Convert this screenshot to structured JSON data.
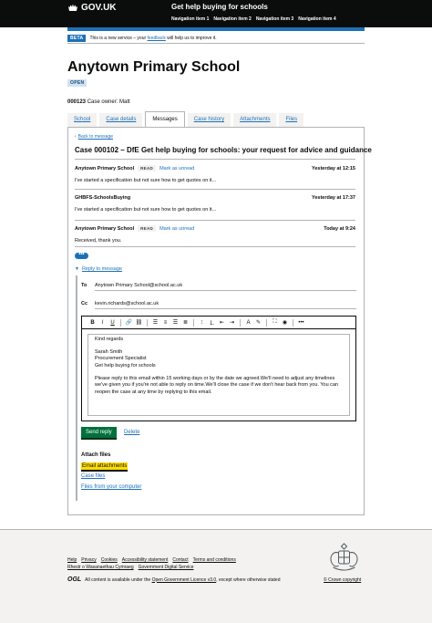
{
  "header": {
    "logo_text": "GOV.UK",
    "service_name": "Get help buying for schools",
    "nav": [
      "Navigation item 1",
      "Navigation item 2",
      "Navigation item 3",
      "Navigation item 4"
    ]
  },
  "phase_banner": {
    "tag": "BETA",
    "text_before": "This is a new service – your",
    "link": "feedback",
    "text_after": "will help us to improve it."
  },
  "page": {
    "title": "Anytown Primary School",
    "status_tag": "OPEN",
    "case_number": "000123",
    "case_owner": "Case owner: Matt"
  },
  "tabs": [
    "School",
    "Case details",
    "Messages",
    "Case history",
    "Attachments",
    "Files"
  ],
  "active_tab": "Messages",
  "thread": {
    "back_link": "Back to message",
    "title": "Case 000102 – DfE Get help buying for schools: your request for advice and guidance",
    "messages": [
      {
        "from": "Anytown Primary School",
        "tag": "READ",
        "action": "Mark as unread",
        "time": "Yesterday at 12:15",
        "body": "I've started a specification but not sure how to get quotes on it..."
      },
      {
        "from": "GHBFS-SchoolsBuying",
        "tag": "",
        "action": "",
        "time": "Yesterday at 17:37",
        "body": "I've started a specification but not sure how to get quotes on it..."
      },
      {
        "from": "Anytown Primary School",
        "tag": "READ",
        "action": "Mark as unread",
        "time": "Today at 9:24",
        "body": "Received, thank you."
      }
    ],
    "more_button": "•••"
  },
  "reply": {
    "toggle_label": "Reply to message",
    "to_label": "To",
    "to_value": "Anytown Primary School@school.ac.uk",
    "cc_label": "Cc",
    "cc_value": "kevin.richards@school.ac.uk",
    "toolbar": [
      "B",
      "I",
      "U",
      "link",
      "unlink",
      "align-left",
      "align-center",
      "align-right",
      "justify",
      "bullet-list",
      "numbered-list",
      "outdent",
      "indent",
      "text-color",
      "highlight",
      "fullscreen",
      "preview",
      "more"
    ],
    "body_greeting": "Kind regards",
    "signature": [
      "Sarah Smith",
      "Procurement Specialist",
      "Get help buying for schools"
    ],
    "body_paragraph": "Please reply to this email within 15 working days or by the date we agreed.We'll need to adjust any timelines we've given you if you're not able to reply on time.We'll close the case if we don't hear back from you. You can reopen the case at any time by replying to this email.",
    "send_label": "Send reply",
    "delete_label": "Delete",
    "attach_heading": "Attach files",
    "attach_links": [
      "Email attachments",
      "Case files",
      "Files from your computer"
    ]
  },
  "footer": {
    "links": [
      "Help",
      "Privacy",
      "Cookies",
      "Accessibility statement",
      "Contact",
      "Terms and conditions",
      "Rhestr o Wasanaethau Cymraeg",
      "Government Digital Service"
    ],
    "ogl_logo": "OGL",
    "licence_before": "All content is available under the",
    "licence_link": "Open Government Licence v3.0",
    "licence_after": ", except where otherwise stated",
    "copyright": "© Crown copyright"
  }
}
